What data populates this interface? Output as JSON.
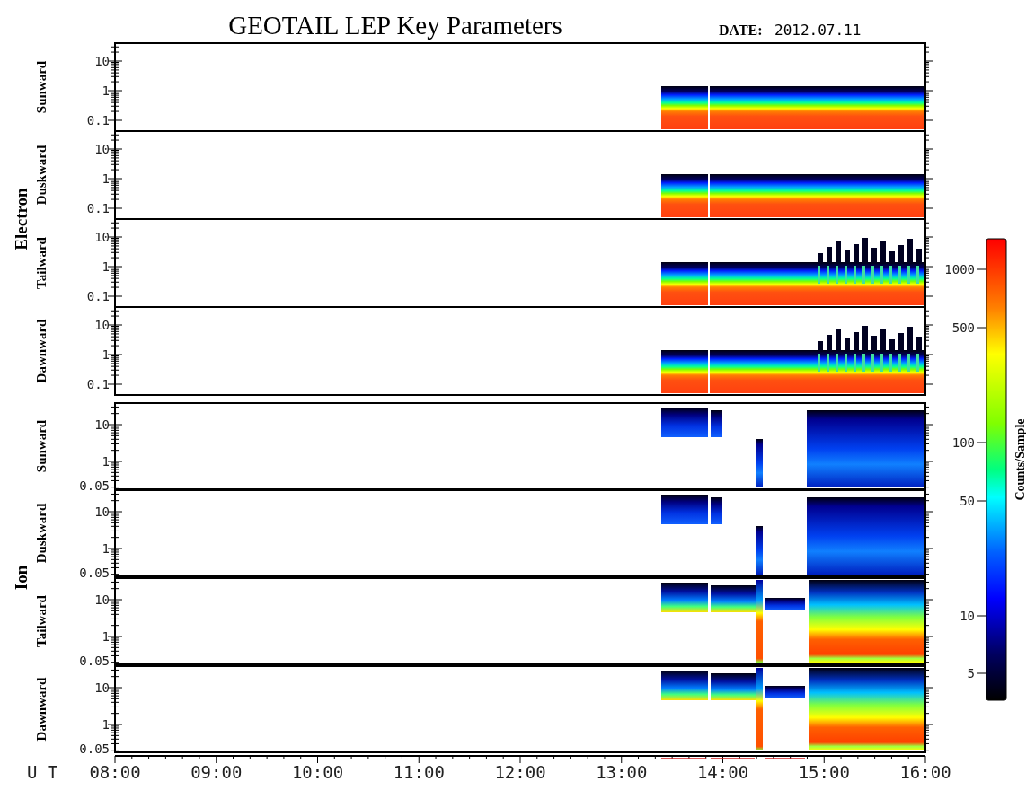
{
  "title": "GEOTAIL LEP Key Parameters",
  "date_label": "DATE:",
  "date": "2012.07.11",
  "groups": [
    {
      "label": "Electron",
      "kind": "electron",
      "panels": [
        {
          "label": "Sunward",
          "yticks": [
            "10",
            "1",
            "0.1"
          ]
        },
        {
          "label": "Duskward",
          "yticks": [
            "10",
            "1",
            "0.1"
          ]
        },
        {
          "label": "Tailward",
          "yticks": [
            "10",
            "1",
            "0.1"
          ]
        },
        {
          "label": "Dawnward",
          "yticks": [
            "10",
            "1",
            "0.1"
          ]
        }
      ]
    },
    {
      "label": "Ion",
      "kind": "ion",
      "panels": [
        {
          "label": "Sunward",
          "yticks": [
            "10",
            "1",
            "0.05"
          ]
        },
        {
          "label": "Duskward",
          "yticks": [
            "10",
            "1",
            "0.05"
          ]
        },
        {
          "label": "Tailward",
          "yticks": [
            "10",
            "1",
            "0.05"
          ]
        },
        {
          "label": "Dawnward",
          "yticks": [
            "10",
            "1",
            "0.05"
          ]
        }
      ]
    }
  ],
  "time_axis": {
    "label": "U T",
    "ticks": [
      "08:00",
      "09:00",
      "10:00",
      "11:00",
      "12:00",
      "13:00",
      "14:00",
      "15:00",
      "16:00"
    ]
  },
  "colorbar": {
    "label": "Counts/Sample",
    "ticks": [
      "1000",
      "500",
      "100",
      "50",
      "10",
      "5"
    ]
  }
}
